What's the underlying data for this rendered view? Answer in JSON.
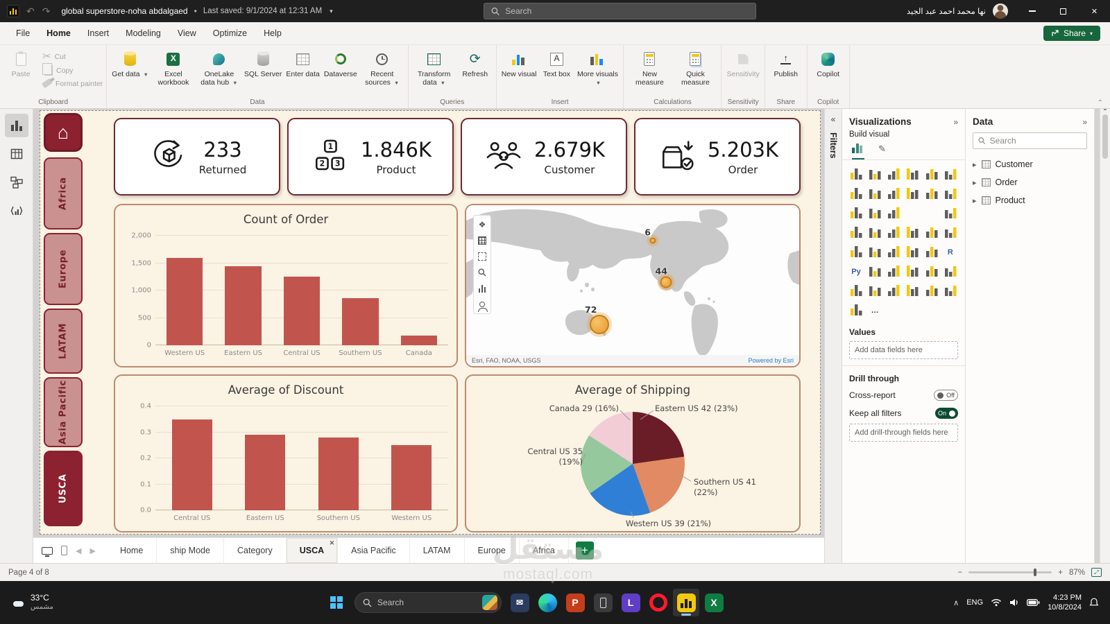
{
  "titlebar": {
    "title": "global superstore-noha abdalgaed",
    "separator": "•",
    "last_saved": "Last saved: 9/1/2024 at 12:31 AM",
    "search_placeholder": "Search",
    "user_name": "نها محمد احمد عبد الجيد"
  },
  "menubar": {
    "items": [
      "File",
      "Home",
      "Insert",
      "Modeling",
      "View",
      "Optimize",
      "Help"
    ],
    "active_item": "Home",
    "share_label": "Share"
  },
  "ribbon": {
    "groups": [
      {
        "label": "Clipboard",
        "layout": "clipboard",
        "buttons": [
          {
            "label": "Paste",
            "icon": "paste-icon",
            "disabled": true
          },
          {
            "label": "Cut",
            "icon": "cut-icon",
            "disabled": true,
            "small": true
          },
          {
            "label": "Copy",
            "icon": "copy-icon",
            "disabled": true,
            "small": true
          },
          {
            "label": "Format painter",
            "icon": "format-painter-icon",
            "disabled": true,
            "small": true
          }
        ]
      },
      {
        "label": "Data",
        "buttons": [
          {
            "label": "Get data",
            "icon": "database-icon",
            "caret": true
          },
          {
            "label": "Excel workbook",
            "icon": "excel-icon"
          },
          {
            "label": "OneLake data hub",
            "icon": "onelake-icon",
            "caret": true
          },
          {
            "label": "SQL Server",
            "icon": "sql-server-icon"
          },
          {
            "label": "Enter data",
            "icon": "enter-data-icon"
          },
          {
            "label": "Dataverse",
            "icon": "dataverse-icon"
          },
          {
            "label": "Recent sources",
            "icon": "recent-sources-icon",
            "caret": true
          }
        ]
      },
      {
        "label": "Queries",
        "buttons": [
          {
            "label": "Transform data",
            "icon": "transform-data-icon",
            "caret": true
          },
          {
            "label": "Refresh",
            "icon": "refresh-icon"
          }
        ]
      },
      {
        "label": "Insert",
        "buttons": [
          {
            "label": "New visual",
            "icon": "new-visual-icon"
          },
          {
            "label": "Text box",
            "icon": "text-box-icon"
          },
          {
            "label": "More visuals",
            "icon": "more-visuals-icon",
            "caret": true
          }
        ]
      },
      {
        "label": "Calculations",
        "buttons": [
          {
            "label": "New measure",
            "icon": "new-measure-icon"
          },
          {
            "label": "Quick measure",
            "icon": "quick-measure-icon"
          }
        ]
      },
      {
        "label": "Sensitivity",
        "buttons": [
          {
            "label": "Sensitivity",
            "icon": "sensitivity-icon",
            "disabled": true
          }
        ]
      },
      {
        "label": "Share",
        "buttons": [
          {
            "label": "Publish",
            "icon": "publish-icon"
          }
        ]
      },
      {
        "label": "Copilot",
        "buttons": [
          {
            "label": "Copilot",
            "icon": "copilot-icon"
          }
        ]
      }
    ]
  },
  "view_rail": {
    "items": [
      {
        "name": "report-view",
        "active": true
      },
      {
        "name": "table-view",
        "active": false
      },
      {
        "name": "model-view",
        "active": false
      },
      {
        "name": "dax-query-view",
        "active": false
      }
    ]
  },
  "dashboard": {
    "nav_items": [
      {
        "label": "Africa",
        "active": false
      },
      {
        "label": "Europe",
        "active": false
      },
      {
        "label": "LATAM",
        "active": false
      },
      {
        "label": "Asia Pacific",
        "active": false
      },
      {
        "label": "USCA",
        "active": true
      }
    ],
    "kpis": [
      {
        "value": "233",
        "label": "Returned",
        "icon": "returned-icon"
      },
      {
        "value": "1.846K",
        "label": "Product",
        "icon": "product-icon"
      },
      {
        "value": "2.679K",
        "label": "Customer",
        "icon": "customer-icon"
      },
      {
        "value": "5.203K",
        "label": "Order",
        "icon": "order-icon"
      }
    ]
  },
  "chart_data": [
    {
      "type": "bar",
      "title": "Count of Order",
      "categories": [
        "Western US",
        "Eastern US",
        "Central US",
        "Southern US",
        "Canada"
      ],
      "values": [
        1600,
        1440,
        1250,
        860,
        180
      ],
      "ylim": [
        0,
        2000
      ],
      "yticks": [
        {
          "value": 0,
          "label": "0"
        },
        {
          "value": 500,
          "label": "500"
        },
        {
          "value": 1000,
          "label": "1,000"
        },
        {
          "value": 1500,
          "label": "1,500"
        },
        {
          "value": 2000,
          "label": "2,000"
        }
      ],
      "bar_color": "#c2544e",
      "grid": true,
      "legend": "none"
    },
    {
      "type": "map",
      "bubbles": [
        {
          "label": "6",
          "x": 56,
          "y": 22,
          "size": 9
        },
        {
          "label": "44",
          "x": 60,
          "y": 48,
          "size": 17
        },
        {
          "label": "72",
          "x": 40,
          "y": 74,
          "size": 28
        }
      ],
      "tools": [
        "layers-icon",
        "basemap-grid-icon",
        "selection-box-icon",
        "search-icon",
        "chart-icon",
        "person-icon"
      ],
      "attribution": "Esri, FAO, NOAA, USGS",
      "powered_by": "Powered by Esri",
      "bubble_color": "#efa33d"
    },
    {
      "type": "bar",
      "title": "Average of Discount",
      "categories": [
        "Central US",
        "Eastern US",
        "Southern US",
        "Western US"
      ],
      "values": [
        0.35,
        0.29,
        0.28,
        0.25
      ],
      "ylim": [
        0,
        0.4
      ],
      "yticks": [
        {
          "value": 0,
          "label": "0.0"
        },
        {
          "value": 0.1,
          "label": "0.1"
        },
        {
          "value": 0.2,
          "label": "0.2"
        },
        {
          "value": 0.3,
          "label": "0.3"
        },
        {
          "value": 0.4,
          "label": "0.4"
        }
      ],
      "bar_color": "#c2544e",
      "grid": true,
      "legend": "none"
    },
    {
      "type": "pie",
      "title": "Average of Shipping",
      "slices": [
        {
          "name": "Eastern US",
          "value": 42,
          "pct": 23,
          "label": "Eastern US 42 (23%)",
          "color": "#6b1d27"
        },
        {
          "name": "Southern US",
          "value": 41,
          "pct": 22,
          "label": "Southern US 41 (22%)",
          "color": "#e18a64"
        },
        {
          "name": "Western US",
          "value": 39,
          "pct": 21,
          "label": "Western US 39 (21%)",
          "color": "#2f7fd6"
        },
        {
          "name": "Central US",
          "value": 35,
          "pct": 19,
          "label": "Central US 35 (19%)",
          "color": "#95c89c"
        },
        {
          "name": "Canada",
          "value": 29,
          "pct": 16,
          "label": "Canada 29 (16%)",
          "color": "#f2cdd5"
        }
      ]
    }
  ],
  "filters_pane": {
    "label": "Filters"
  },
  "visualizations_pane": {
    "title": "Visualizations",
    "build_label": "Build visual",
    "visual_icons": [
      "stacked-bar-chart",
      "stacked-column-chart",
      "clustered-bar-chart",
      "clustered-column-chart",
      "100-stacked-bar-chart",
      "100-stacked-column-chart",
      "line-chart",
      "area-chart",
      "stacked-area-chart",
      "line-and-stacked-column-chart",
      "line-and-clustered-column-chart",
      "ribbon-chart",
      "waterfall-chart",
      "funnel-chart",
      "scatter-chart",
      "pie-chart",
      "donut-chart",
      "treemap",
      "map",
      "filled-map",
      "shape-map",
      "azure-map",
      "gauge",
      "card",
      "multi-row-card",
      "kpi",
      "slicer",
      "table",
      "matrix",
      "r-script-visual",
      "python-visual",
      "key-influencers",
      "decomposition-tree",
      "qa-visual",
      "narrative-visual",
      "metrics",
      "paginated-report",
      "arcgis-map",
      "power-apps",
      "power-automate",
      "text-slicer",
      "button-slicer",
      "get-more-visuals",
      "more-options"
    ],
    "values_label": "Values",
    "add_fields_placeholder": "Add data fields here",
    "drill_through_label": "Drill through",
    "cross_report_label": "Cross-report",
    "cross_report_state": "Off",
    "keep_filters_label": "Keep all filters",
    "keep_filters_state": "On",
    "add_drill_placeholder": "Add drill-through fields here"
  },
  "data_pane": {
    "title": "Data",
    "search_placeholder": "Search",
    "tables": [
      {
        "name": "Customer"
      },
      {
        "name": "Order"
      },
      {
        "name": "Product"
      }
    ]
  },
  "pages_bar": {
    "tabs": [
      {
        "label": "Home",
        "active": false
      },
      {
        "label": "ship Mode",
        "active": false
      },
      {
        "label": "Category",
        "active": false
      },
      {
        "label": "USCA",
        "active": true
      },
      {
        "label": "Asia Pacific",
        "active": false
      },
      {
        "label": "LATAM",
        "active": false
      },
      {
        "label": "Europe",
        "active": false
      },
      {
        "label": "Africa",
        "active": false
      }
    ]
  },
  "statusbar": {
    "page_label": "Page 4 of 8",
    "zoom_level": "87%"
  },
  "taskbar": {
    "weather_temp": "33°C",
    "weather_desc": "مشمس",
    "search_placeholder": "Search",
    "apps": [
      {
        "name": "mail"
      },
      {
        "name": "edge"
      },
      {
        "name": "powerpoint"
      },
      {
        "name": "phone-link"
      },
      {
        "name": "lightshot"
      },
      {
        "name": "opera"
      },
      {
        "name": "power-bi",
        "active": true
      },
      {
        "name": "excel"
      },
      {
        "name": "chrome"
      }
    ],
    "tray_lang": "ENG",
    "time": "4:23 PM",
    "date": "10/8/2024"
  },
  "watermark": {
    "line1": "مستقل",
    "line2": "mostaql.com"
  }
}
